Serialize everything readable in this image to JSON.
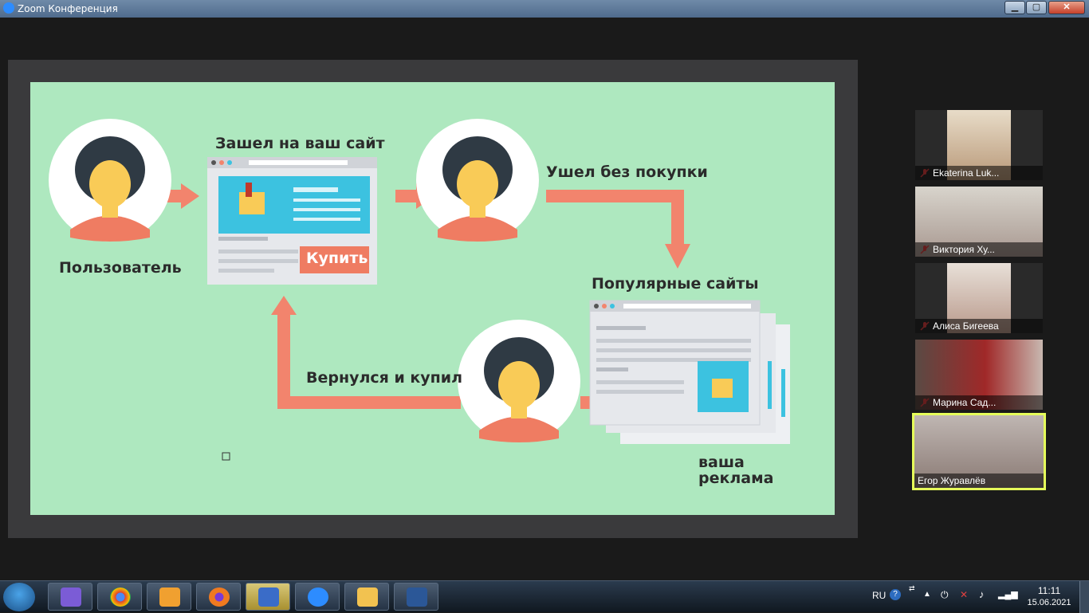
{
  "window": {
    "title": "Zoom Конференция",
    "min_label": "▁",
    "max_label": "▢",
    "close_label": "✕"
  },
  "slide": {
    "labels": {
      "user": "Пользователь",
      "visited": "Зашел на ваш сайт",
      "left": "Ушел без покупки",
      "popular": "Популярные сайты",
      "returned": "Вернулся и купил",
      "ad_line1": "ваша",
      "ad_line2": "реклама",
      "buy_button": "Купить"
    },
    "colors": {
      "background": "#aee8bf",
      "arrow": "#f2846d",
      "site_blue": "#3cc2e0"
    }
  },
  "participants": [
    {
      "name": "Ekaterina Luk...",
      "muted": true
    },
    {
      "name": "Виктория  Ху...",
      "muted": true
    },
    {
      "name": "Алиса Бигеева",
      "muted": true
    },
    {
      "name": "Марина Сад...",
      "muted": true
    },
    {
      "name": "Егор Журавлёв",
      "muted": false,
      "active_speaker": true
    }
  ],
  "taskbar": {
    "apps": [
      "viber",
      "chrome",
      "media-player",
      "firefox",
      "security-shield",
      "zoom",
      "file-explorer",
      "word"
    ],
    "language": "RU",
    "time": "11:11",
    "date": "15.06.2021"
  }
}
